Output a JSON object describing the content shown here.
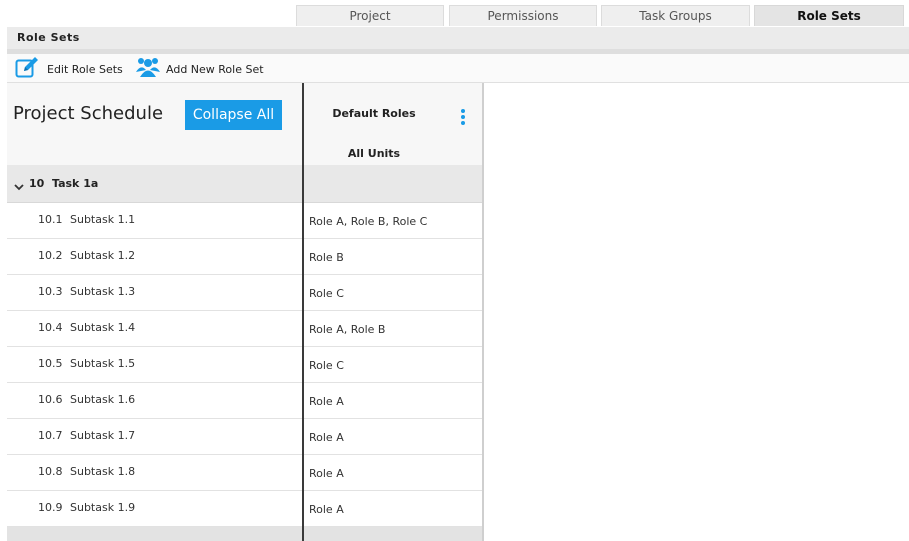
{
  "tabs": [
    {
      "label": "Project",
      "active": false
    },
    {
      "label": "Permissions",
      "active": false
    },
    {
      "label": "Task Groups",
      "active": false
    },
    {
      "label": "Role Sets",
      "active": true
    }
  ],
  "section": {
    "title": "Role Sets"
  },
  "toolbar": {
    "edit_label": "Edit Role Sets",
    "add_label": "Add New Role Set",
    "edit_icon": "edit-icon",
    "add_icon": "users-add-icon"
  },
  "schedule": {
    "title": "Project Schedule",
    "collapse_label": "Collapse All",
    "group": {
      "num": "10",
      "name": "Task 1a"
    },
    "rows": [
      {
        "num": "10.1",
        "name": "Subtask 1.1"
      },
      {
        "num": "10.2",
        "name": "Subtask 1.2"
      },
      {
        "num": "10.3",
        "name": "Subtask 1.3"
      },
      {
        "num": "10.4",
        "name": "Subtask 1.4"
      },
      {
        "num": "10.5",
        "name": "Subtask 1.5"
      },
      {
        "num": "10.6",
        "name": "Subtask 1.6"
      },
      {
        "num": "10.7",
        "name": "Subtask 1.7"
      },
      {
        "num": "10.8",
        "name": "Subtask 1.8"
      },
      {
        "num": "10.9",
        "name": "Subtask 1.9"
      }
    ]
  },
  "roles_column": {
    "title": "Default Roles",
    "subtitle": "All Units",
    "values": [
      "Role A, Role B, Role C",
      "Role B",
      "Role C",
      "Role A, Role B",
      "Role C",
      "Role A",
      "Role A",
      "Role A",
      "Role A"
    ]
  },
  "colors": {
    "accent": "#1a9be6",
    "header_bg": "#ebebeb",
    "group_bg": "#e8e8e8"
  }
}
